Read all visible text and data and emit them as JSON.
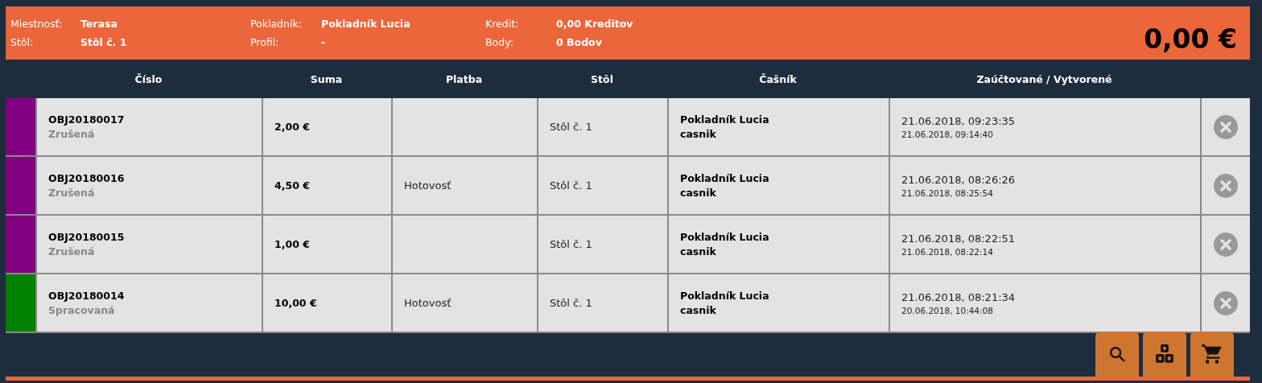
{
  "info": {
    "left": [
      {
        "label": "Miestnosť:",
        "value": "Terasa"
      },
      {
        "label": "Stôl:",
        "value": "Stôl č. 1"
      }
    ],
    "middle": [
      {
        "label": "Pokladník:",
        "value": "Pokladník Lucia"
      },
      {
        "label": "Profil:",
        "value": "-"
      }
    ],
    "right": [
      {
        "label": "Kredit:",
        "value": "0,00 Kreditov"
      },
      {
        "label": "Body:",
        "value": "0 Bodov"
      }
    ],
    "total": "0,00 €"
  },
  "table": {
    "columns": [
      "Číslo",
      "Suma",
      "Platba",
      "Stôl",
      "Čašník",
      "Zaúčtované / Vytvorené"
    ],
    "rows": [
      {
        "color": "#800080",
        "number": "OBJ20180017",
        "status": "Zrušená",
        "sum": "2,00 €",
        "payment": "",
        "table": "Stôl č. 1",
        "waiter": "Pokladník Lucia",
        "waiter_role": "casnik",
        "posted": "21.06.2018, 09:23:35",
        "created": "21.06.2018, 09:14:40"
      },
      {
        "color": "#800080",
        "number": "OBJ20180016",
        "status": "Zrušená",
        "sum": "4,50 €",
        "payment": "Hotovosť",
        "table": "Stôl č. 1",
        "waiter": "Pokladník Lucia",
        "waiter_role": "casnik",
        "posted": "21.06.2018, 08:26:26",
        "created": "21.06.2018, 08:25:54"
      },
      {
        "color": "#800080",
        "number": "OBJ20180015",
        "status": "Zrušená",
        "sum": "1,00 €",
        "payment": "",
        "table": "Stôl č. 1",
        "waiter": "Pokladník Lucia",
        "waiter_role": "casnik",
        "posted": "21.06.2018, 08:22:51",
        "created": "21.06.2018, 08:22:14"
      },
      {
        "color": "#008000",
        "number": "OBJ20180014",
        "status": "Spracovaná",
        "sum": "10,00 €",
        "payment": "Hotovosť",
        "table": "Stôl č. 1",
        "waiter": "Pokladník Lucia",
        "waiter_role": "casnik",
        "posted": "21.06.2018, 08:21:34",
        "created": "20.06.2018, 10:44:08"
      }
    ]
  },
  "toolbar": [
    {
      "kind": "search"
    },
    {
      "kind": "blocks"
    },
    {
      "kind": "cart"
    }
  ]
}
